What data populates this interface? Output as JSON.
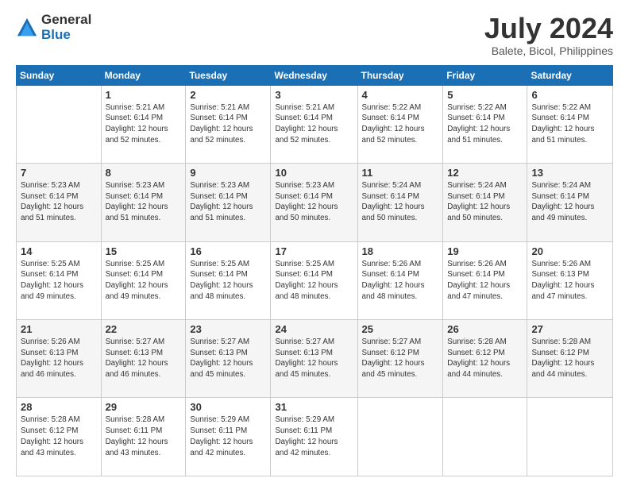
{
  "header": {
    "logo_general": "General",
    "logo_blue": "Blue",
    "month_title": "July 2024",
    "location": "Balete, Bicol, Philippines"
  },
  "calendar": {
    "days_of_week": [
      "Sunday",
      "Monday",
      "Tuesday",
      "Wednesday",
      "Thursday",
      "Friday",
      "Saturday"
    ],
    "weeks": [
      [
        {
          "num": "",
          "info": ""
        },
        {
          "num": "1",
          "info": "Sunrise: 5:21 AM\nSunset: 6:14 PM\nDaylight: 12 hours\nand 52 minutes."
        },
        {
          "num": "2",
          "info": "Sunrise: 5:21 AM\nSunset: 6:14 PM\nDaylight: 12 hours\nand 52 minutes."
        },
        {
          "num": "3",
          "info": "Sunrise: 5:21 AM\nSunset: 6:14 PM\nDaylight: 12 hours\nand 52 minutes."
        },
        {
          "num": "4",
          "info": "Sunrise: 5:22 AM\nSunset: 6:14 PM\nDaylight: 12 hours\nand 52 minutes."
        },
        {
          "num": "5",
          "info": "Sunrise: 5:22 AM\nSunset: 6:14 PM\nDaylight: 12 hours\nand 51 minutes."
        },
        {
          "num": "6",
          "info": "Sunrise: 5:22 AM\nSunset: 6:14 PM\nDaylight: 12 hours\nand 51 minutes."
        }
      ],
      [
        {
          "num": "7",
          "info": "Sunrise: 5:23 AM\nSunset: 6:14 PM\nDaylight: 12 hours\nand 51 minutes."
        },
        {
          "num": "8",
          "info": "Sunrise: 5:23 AM\nSunset: 6:14 PM\nDaylight: 12 hours\nand 51 minutes."
        },
        {
          "num": "9",
          "info": "Sunrise: 5:23 AM\nSunset: 6:14 PM\nDaylight: 12 hours\nand 51 minutes."
        },
        {
          "num": "10",
          "info": "Sunrise: 5:23 AM\nSunset: 6:14 PM\nDaylight: 12 hours\nand 50 minutes."
        },
        {
          "num": "11",
          "info": "Sunrise: 5:24 AM\nSunset: 6:14 PM\nDaylight: 12 hours\nand 50 minutes."
        },
        {
          "num": "12",
          "info": "Sunrise: 5:24 AM\nSunset: 6:14 PM\nDaylight: 12 hours\nand 50 minutes."
        },
        {
          "num": "13",
          "info": "Sunrise: 5:24 AM\nSunset: 6:14 PM\nDaylight: 12 hours\nand 49 minutes."
        }
      ],
      [
        {
          "num": "14",
          "info": "Sunrise: 5:25 AM\nSunset: 6:14 PM\nDaylight: 12 hours\nand 49 minutes."
        },
        {
          "num": "15",
          "info": "Sunrise: 5:25 AM\nSunset: 6:14 PM\nDaylight: 12 hours\nand 49 minutes."
        },
        {
          "num": "16",
          "info": "Sunrise: 5:25 AM\nSunset: 6:14 PM\nDaylight: 12 hours\nand 48 minutes."
        },
        {
          "num": "17",
          "info": "Sunrise: 5:25 AM\nSunset: 6:14 PM\nDaylight: 12 hours\nand 48 minutes."
        },
        {
          "num": "18",
          "info": "Sunrise: 5:26 AM\nSunset: 6:14 PM\nDaylight: 12 hours\nand 48 minutes."
        },
        {
          "num": "19",
          "info": "Sunrise: 5:26 AM\nSunset: 6:14 PM\nDaylight: 12 hours\nand 47 minutes."
        },
        {
          "num": "20",
          "info": "Sunrise: 5:26 AM\nSunset: 6:13 PM\nDaylight: 12 hours\nand 47 minutes."
        }
      ],
      [
        {
          "num": "21",
          "info": "Sunrise: 5:26 AM\nSunset: 6:13 PM\nDaylight: 12 hours\nand 46 minutes."
        },
        {
          "num": "22",
          "info": "Sunrise: 5:27 AM\nSunset: 6:13 PM\nDaylight: 12 hours\nand 46 minutes."
        },
        {
          "num": "23",
          "info": "Sunrise: 5:27 AM\nSunset: 6:13 PM\nDaylight: 12 hours\nand 45 minutes."
        },
        {
          "num": "24",
          "info": "Sunrise: 5:27 AM\nSunset: 6:13 PM\nDaylight: 12 hours\nand 45 minutes."
        },
        {
          "num": "25",
          "info": "Sunrise: 5:27 AM\nSunset: 6:12 PM\nDaylight: 12 hours\nand 45 minutes."
        },
        {
          "num": "26",
          "info": "Sunrise: 5:28 AM\nSunset: 6:12 PM\nDaylight: 12 hours\nand 44 minutes."
        },
        {
          "num": "27",
          "info": "Sunrise: 5:28 AM\nSunset: 6:12 PM\nDaylight: 12 hours\nand 44 minutes."
        }
      ],
      [
        {
          "num": "28",
          "info": "Sunrise: 5:28 AM\nSunset: 6:12 PM\nDaylight: 12 hours\nand 43 minutes."
        },
        {
          "num": "29",
          "info": "Sunrise: 5:28 AM\nSunset: 6:11 PM\nDaylight: 12 hours\nand 43 minutes."
        },
        {
          "num": "30",
          "info": "Sunrise: 5:29 AM\nSunset: 6:11 PM\nDaylight: 12 hours\nand 42 minutes."
        },
        {
          "num": "31",
          "info": "Sunrise: 5:29 AM\nSunset: 6:11 PM\nDaylight: 12 hours\nand 42 minutes."
        },
        {
          "num": "",
          "info": ""
        },
        {
          "num": "",
          "info": ""
        },
        {
          "num": "",
          "info": ""
        }
      ]
    ]
  }
}
